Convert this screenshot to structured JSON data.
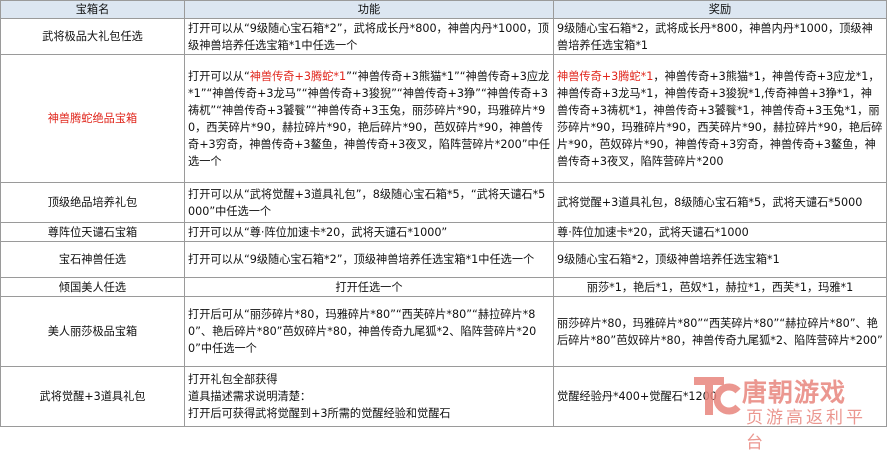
{
  "header": {
    "col_name": "宝箱名",
    "col_function": "功能",
    "col_reward": "奖励"
  },
  "rows": [
    {
      "name": "武将极品大礼包任选",
      "function": "打开可以从“9级随心宝石箱*2”，武将成长丹*800，神兽内丹*1000，顶级神兽培养任选宝箱*1中任选一个",
      "reward": "9级随心宝石箱*2，武将成长丹*800，神兽内丹*1000，顶级神兽培养任选宝箱*1"
    },
    {
      "name": "神兽腾蛇绝品宝箱",
      "function_prefix": "打开可以从“",
      "function_highlight": "神兽传奇+3腾蛇*1",
      "function_rest": "”“神兽传奇+3熊猫*1”“神兽传奇+3应龙*1”“神兽传奇+3龙马”“神兽传奇+3狻猊”“神兽传奇+3狰”“神兽传奇+3祷杌”“神兽传奇+3饕餮”“神兽传奇+3玉兔，丽莎碎片*90，玛雅碎片*90，西芙碎片*90，赫拉碎片*90，艳后碎片*90，芭奴碎片*90，神兽传奇+3穷奇，神兽传奇+3鳌鱼，神兽传奇+3夜叉，陷阵营碎片*200”中任选一个",
      "reward_highlight": "神兽传奇+3腾蛇*1",
      "reward_rest": "，神兽传奇+3熊猫*1，神兽传奇+3应龙*1，神兽传奇+3龙马*1，神兽传奇+3狻猊*1,传奇神兽+3狰*1，神兽传奇+3祷杌*1，神兽传奇+3饕餮*1，神兽传奇+3玉兔*1，丽莎碎片*90，玛雅碎片*90，西芙碎片*90，赫拉碎片*90，艳后碎片*90，芭奴碎片*90，神兽传奇+3穷奇，神兽传奇+3鳌鱼，神兽传奇+3夜叉，陷阵营碎片*200"
    },
    {
      "name": "顶级绝品培养礼包",
      "function": "打开可以从“武将觉醒+3道具礼包”，8级随心宝石箱*5，“武将天谴石*5000”中任选一个",
      "reward": "武将觉醒+3道具礼包，8级随心宝石箱*5，武将天谴石*5000"
    },
    {
      "name": "尊阵位天谴石宝箱",
      "function": "打开可以从“尊·阵位加速卡*20，武将天谴石*1000”",
      "reward": "尊·阵位加速卡*20，武将天谴石*1000"
    },
    {
      "name": "宝石神兽任选",
      "function": "打开可以从“9级随心宝石箱*2”，顶级神兽培养任选宝箱*1中任选一个",
      "reward": "9级随心宝石箱*2，顶级神兽培养任选宝箱*1"
    },
    {
      "name": "倾国美人任选",
      "function": "打开任选一个",
      "reward": "丽莎*1，艳后*1，芭奴*1，赫拉*1，西芙*1，玛雅*1"
    },
    {
      "name": "美人丽莎极品宝箱",
      "function": "打开后可从“丽莎碎片*80，玛雅碎片*80”“西芙碎片*80”“赫拉碎片*80”、艳后碎片*80”芭奴碎片*80，神兽传奇九尾狐*2、陷阵营碎片*200”中任选一个",
      "reward": "丽莎碎片*80，玛雅碎片*80”“西芙碎片*80”“赫拉碎片*80”、艳后碎片*80”芭奴碎片*80，神兽传奇九尾狐*2、陷阵营碎片*200”"
    },
    {
      "name": "武将觉醒+3道具礼包",
      "function_lines": [
        "打开礼包全部获得",
        "道具描述需求说明清楚：",
        "打开后可获得武将觉醒到+3所需的觉醒经验和觉醒石"
      ],
      "reward": "觉醒经验丹*400+觉醒石*1200"
    }
  ],
  "watermark": {
    "brand": "唐朝游戏",
    "slogan": "页游高返利平台",
    "logo_letters": "TC"
  },
  "colors": {
    "highlight": "#e0251b",
    "header_bg": "#dce6f1",
    "border": "#9a9a9a",
    "watermark": "#e8867d"
  }
}
